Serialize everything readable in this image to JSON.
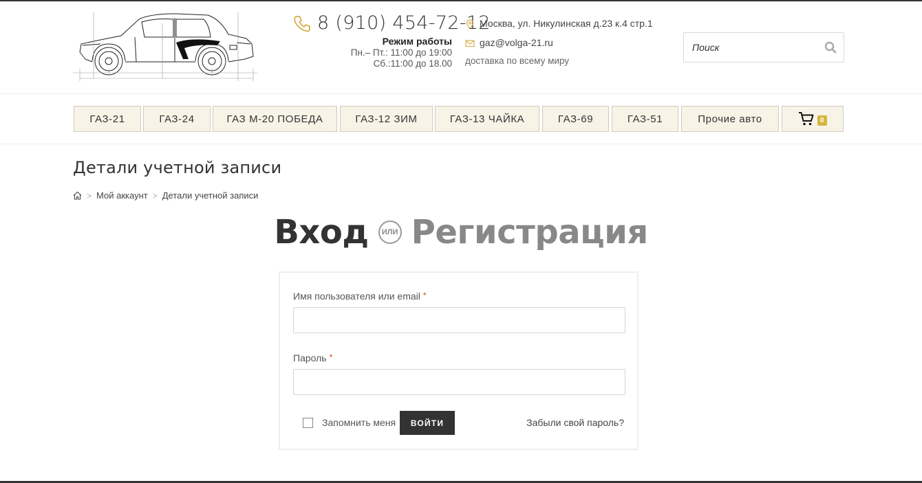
{
  "colors": {
    "accent": "#d4b740",
    "nav_bg": "#f7f3e7",
    "button_dark": "#333333",
    "required": "#e2401c",
    "icon_gold": "#d6ab48"
  },
  "header": {
    "logo_icon": "volga-car-blueprint",
    "phone_icon": "phone-icon",
    "phone": "8 (910) 454-72-12",
    "hours_title": "Режим работы",
    "hours_weekdays": "Пн.– Пт.: 11:00 до 19:00",
    "hours_saturday": "Сб.:11:00 до 18.00",
    "address_icon": "map-pin-icon",
    "address": "Москва, ул. Никулинская д.23 к.4 стр.1",
    "email_icon": "envelope-icon",
    "email": "gaz@volga-21.ru",
    "delivery": "доставка по всему миру",
    "search": {
      "placeholder": "Поиск",
      "value": ""
    }
  },
  "nav": {
    "items": [
      {
        "label": "ГАЗ-21"
      },
      {
        "label": "ГАЗ-24"
      },
      {
        "label": "ГАЗ М-20 ПОБЕДА"
      },
      {
        "label": "ГАЗ-12 ЗИМ"
      },
      {
        "label": "ГАЗ-13 ЧАЙКА"
      },
      {
        "label": "ГАЗ-69"
      },
      {
        "label": "ГАЗ-51"
      },
      {
        "label": "Прочие авто"
      }
    ],
    "cart_count": "0"
  },
  "page": {
    "title": "Детали учетной записи",
    "breadcrumb": {
      "home_icon": "home-icon",
      "separator": ">",
      "my_account": "Мой аккаунт",
      "current": "Детали учетной записи"
    },
    "auth": {
      "login_tab": "Вход",
      "or_label": "ИЛИ",
      "register_tab": "Регистрация"
    },
    "form": {
      "username_label": "Имя пользователя или email",
      "password_label": "Пароль",
      "required_mark": "*",
      "username_value": "",
      "password_value": "",
      "remember_label": "Запомнить меня",
      "remember_checked": false,
      "login_button": "ВОЙТИ",
      "forgot_link": "Забыли свой пароль?"
    }
  }
}
